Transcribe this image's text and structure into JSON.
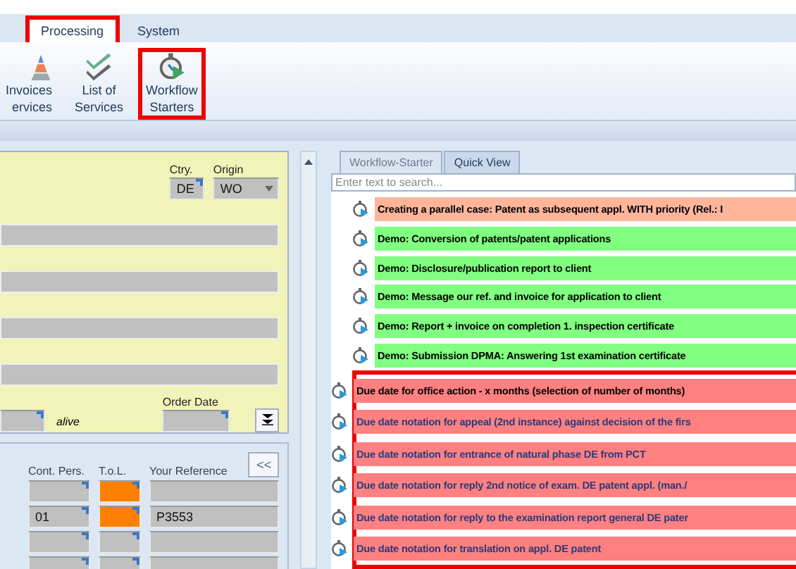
{
  "ribbon": {
    "tabs": [
      {
        "label": "Processing",
        "selected": true,
        "highlighted": true
      },
      {
        "label": "System",
        "selected": false,
        "highlighted": false
      }
    ],
    "buttons": [
      {
        "kind": "invoices",
        "lines": [
          "Invoices",
          "ervices"
        ],
        "highlighted": false
      },
      {
        "kind": "services",
        "lines": [
          "List of",
          "Services"
        ],
        "highlighted": false
      },
      {
        "kind": "workflow",
        "lines": [
          "Workflow",
          "Starters"
        ],
        "highlighted": true
      }
    ]
  },
  "form": {
    "country": {
      "label": "Ctry.",
      "value": "DE"
    },
    "origin": {
      "label": "Origin",
      "value": "WO"
    },
    "status": "alive",
    "order_date": {
      "label": "Order Date"
    }
  },
  "grid": {
    "columns": [
      "Cont. Pers.",
      "T.o.L.",
      "Your Reference"
    ],
    "collapse_button": "<<",
    "rows": [
      {
        "contact": "",
        "color": "#ff8000",
        "reference": ""
      },
      {
        "contact": "01",
        "color": "#ff8000",
        "reference": "P3553"
      },
      {
        "contact": "",
        "color": "#c0c0c0",
        "reference": ""
      },
      {
        "contact": "",
        "color": "#c0c0c0",
        "reference": ""
      }
    ]
  },
  "workflow_panel": {
    "tabs": [
      {
        "label": "Workflow-Starter",
        "selected": true
      },
      {
        "label": "Quick View",
        "selected": false
      }
    ],
    "search": {
      "placeholder": "Enter text to search..."
    },
    "items": [
      {
        "label": "Creating a parallel case: Patent as subsequent appl. WITH priority (Rel.: I",
        "color": "#ffb59a",
        "highlighted": false,
        "emphasized": true
      },
      {
        "label": "Demo: Conversion of patents/patent applications",
        "color": "#80ff80",
        "highlighted": false,
        "emphasized": true
      },
      {
        "label": "Demo: Disclosure/publication report to client",
        "color": "#80ff80",
        "highlighted": false,
        "emphasized": true
      },
      {
        "label": "Demo: Message our ref. and invoice for application to client",
        "color": "#80ff80",
        "highlighted": false,
        "emphasized": true
      },
      {
        "label": "Demo: Report + invoice on completion 1. inspection certificate",
        "color": "#80ff80",
        "highlighted": false,
        "emphasized": true
      },
      {
        "label": "Demo: Submission DPMA: Answering 1st examination certificate",
        "color": "#80ff80",
        "highlighted": false,
        "emphasized": true
      },
      {
        "label": "Due date for office action - x months (selection of number of months)",
        "color": "#ff8080",
        "highlighted": true,
        "emphasized": true
      },
      {
        "label": "Due date notation for appeal (2nd instance) against decision of the firs",
        "color": "#ff8080",
        "highlighted": true,
        "emphasized": false
      },
      {
        "label": "Due date notation for entrance of natural phase DE from PCT",
        "color": "#ff8080",
        "highlighted": true,
        "emphasized": false
      },
      {
        "label": "Due date notation for reply 2nd notice of exam. DE patent appl. (man./",
        "color": "#ff8080",
        "highlighted": true,
        "emphasized": false
      },
      {
        "label": "Due date notation for reply to the examination report general DE pater",
        "color": "#ff8080",
        "highlighted": true,
        "emphasized": false
      },
      {
        "label": "Due date notation for translation on appl. DE patent",
        "color": "#ff8080",
        "highlighted": true,
        "emphasized": false
      }
    ]
  }
}
